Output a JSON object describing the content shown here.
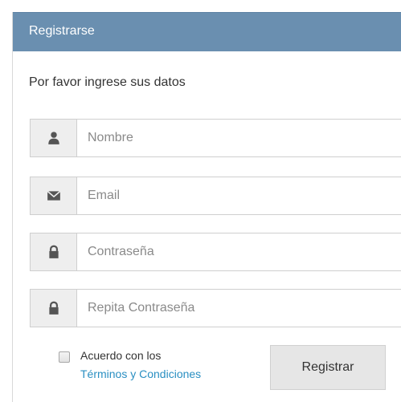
{
  "panel": {
    "title": "Registrarse",
    "header_color": "#6a8fb0"
  },
  "form": {
    "intro": "Por favor ingrese sus datos",
    "fields": [
      {
        "icon": "user-icon",
        "placeholder": "Nombre",
        "value": ""
      },
      {
        "icon": "envelope-icon",
        "placeholder": "Email",
        "value": ""
      },
      {
        "icon": "lock-icon",
        "placeholder": "Contraseña",
        "value": ""
      },
      {
        "icon": "lock-icon",
        "placeholder": "Repita Contraseña",
        "value": ""
      }
    ],
    "agreement": {
      "checked": false,
      "label": "Acuerdo con los",
      "link_text": "Términos y Condiciones",
      "link_color": "#2a8fc2"
    },
    "submit_label": "Registrar"
  }
}
